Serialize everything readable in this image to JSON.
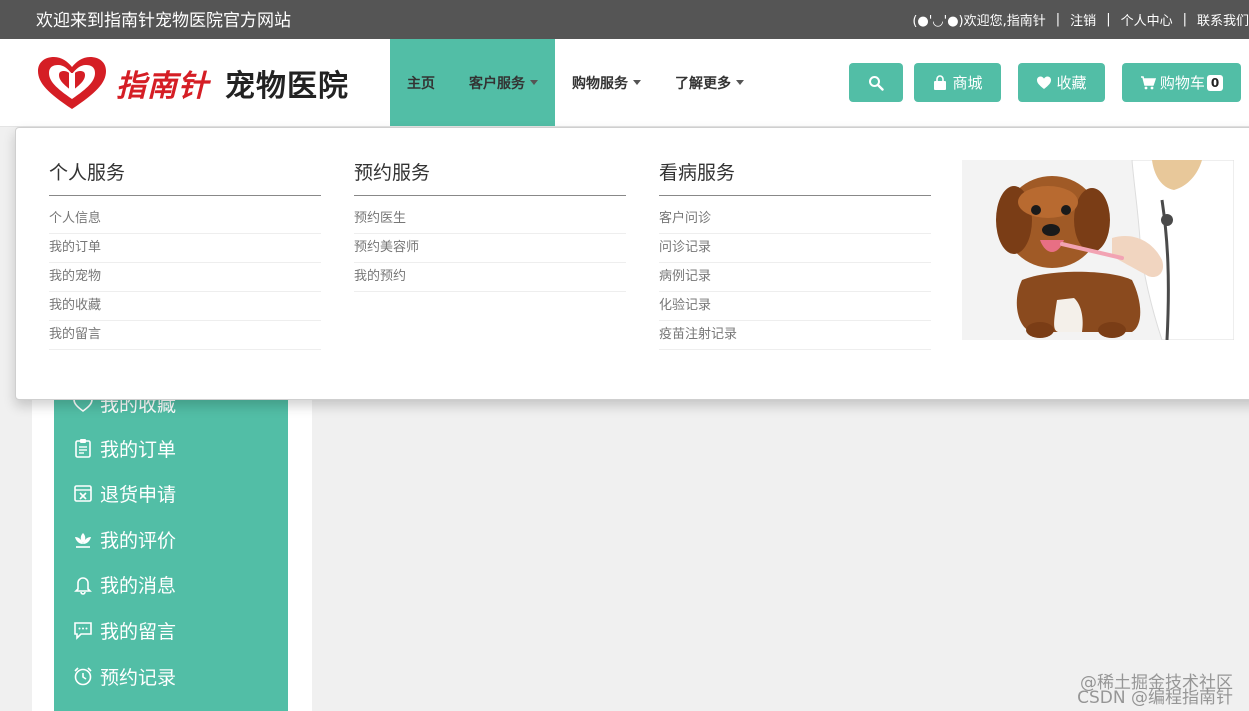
{
  "topbar": {
    "welcome": "欢迎来到指南针宠物医院官方网站",
    "greeting": "(●'◡'●)欢迎您,指南针",
    "logout": "注销",
    "personal_center": "个人中心",
    "contact": "联系我们"
  },
  "logo": {
    "brand_red": "指南针",
    "brand_black": "宠物医院"
  },
  "nav": {
    "home": "主页",
    "customer_service": "客户服务",
    "shopping_service": "购物服务",
    "learn_more": "了解更多"
  },
  "header_buttons": {
    "mall": "商城",
    "favorites": "收藏",
    "cart": "购物车",
    "cart_count": "0"
  },
  "mega_menu": {
    "columns": [
      {
        "title": "个人服务",
        "items": [
          "个人信息",
          "我的订单",
          "我的宠物",
          "我的收藏",
          "我的留言"
        ]
      },
      {
        "title": "预约服务",
        "items": [
          "预约医生",
          "预约美容师",
          "我的预约"
        ]
      },
      {
        "title": "看病服务",
        "items": [
          "客户问诊",
          "问诊记录",
          "病例记录",
          "化验记录",
          "疫苗注射记录"
        ]
      }
    ]
  },
  "sidebar": {
    "items": [
      "我的收藏",
      "我的订单",
      "退货申请",
      "我的评价",
      "我的消息",
      "我的留言",
      "预约记录"
    ]
  },
  "watermark": {
    "line1": "@稀土掘金技术社区",
    "line2": "CSDN @编程指南针"
  },
  "colors": {
    "accent": "#52bea6",
    "topbar": "#555555",
    "brand_red": "#d51e25"
  }
}
